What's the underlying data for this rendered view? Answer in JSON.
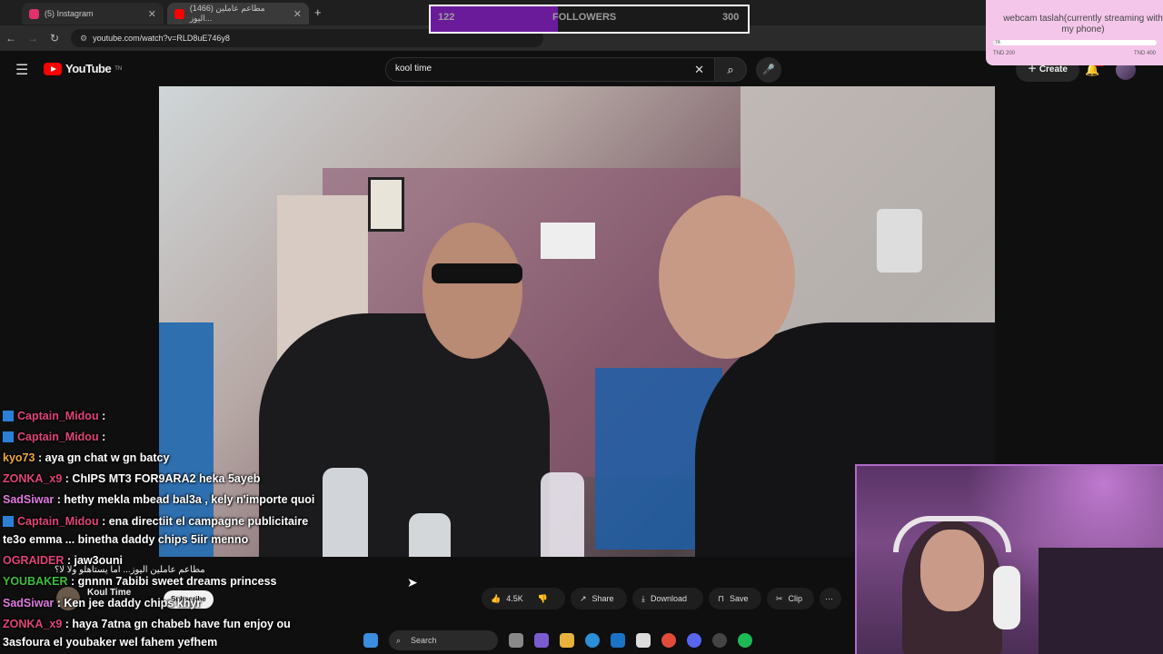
{
  "browser": {
    "tabs": [
      {
        "title": "(5) Instagram",
        "favicon_color": "#e1306c"
      },
      {
        "title": "(1466) مطاعم عاملين اليوز...",
        "favicon_color": "#ff0000"
      }
    ],
    "new_tab_label": "+",
    "url": "youtube.com/watch?v=RLD8uE746y8"
  },
  "youtube": {
    "logo_text": "YouTube",
    "logo_sup": "TN",
    "search_value": "kool time",
    "create_label": "Create",
    "notif_count": "9+",
    "channel_name": "Koul Time",
    "subscribe_label": "Subscribe",
    "video_title_fragment": "مطاعم عاملين اليوز... اما يستاهلو ولا لا؟",
    "actions": {
      "likes": "4.5K",
      "share": "Share",
      "download": "Download",
      "save": "Save",
      "clip": "Clip"
    }
  },
  "followers": {
    "label": "FOLLOWERS",
    "current": "122",
    "goal": "300",
    "fill_fraction": 0.4
  },
  "goal_card": {
    "title": "webcam taslah(currently streaming with my phone)",
    "current_marker": "74",
    "min_label": "TND 200",
    "max_label": "TND 400",
    "fill_fraction": 0.05
  },
  "chat": [
    {
      "user": "Captain_Midou",
      "color": "#e0427a",
      "badge": true,
      "text": ":"
    },
    {
      "user": "Captain_Midou",
      "color": "#e0427a",
      "badge": true,
      "text": ":"
    },
    {
      "user": "kyo73",
      "color": "#f0a640",
      "badge": false,
      "text": ": aya gn chat w gn batcy"
    },
    {
      "user": "ZONKA_x9",
      "color": "#e0427a",
      "badge": false,
      "text": ": ChIPS MT3 FOR9ARA2 heka 5ayeb"
    },
    {
      "user": "SadSiwar",
      "color": "#e07ae0",
      "badge": false,
      "text": ": hethy mekla mbead bal3a , kely n'importe quoi"
    },
    {
      "user": "Captain_Midou",
      "color": "#e0427a",
      "badge": true,
      "text": ": ena directiit el campagne publicitaire"
    },
    {
      "user": "",
      "color": "#ffffff",
      "badge": false,
      "text": "te3o emma ... binetha daddy chips 5iir menno"
    },
    {
      "user": "OGRAIDER",
      "color": "#e0427a",
      "badge": false,
      "text": ": jaw3ouni"
    },
    {
      "user": "YOUBAKER",
      "color": "#3bbf3b",
      "badge": false,
      "text": ": gnnnn 7abibi sweet dreams princess"
    },
    {
      "user": "SadSiwar",
      "color": "#e07ae0",
      "badge": false,
      "text": ": Ken jee daddy chips khyr"
    },
    {
      "user": "ZONKA_x9",
      "color": "#e0427a",
      "badge": false,
      "text": ": haya 7atna gn chabeb have fun enjoy ou"
    },
    {
      "user": "",
      "color": "#ffffff",
      "badge": false,
      "text": "3asfoura el youbaker wel fahem yefhem"
    }
  ],
  "taskbar": {
    "search_label": "Search"
  }
}
